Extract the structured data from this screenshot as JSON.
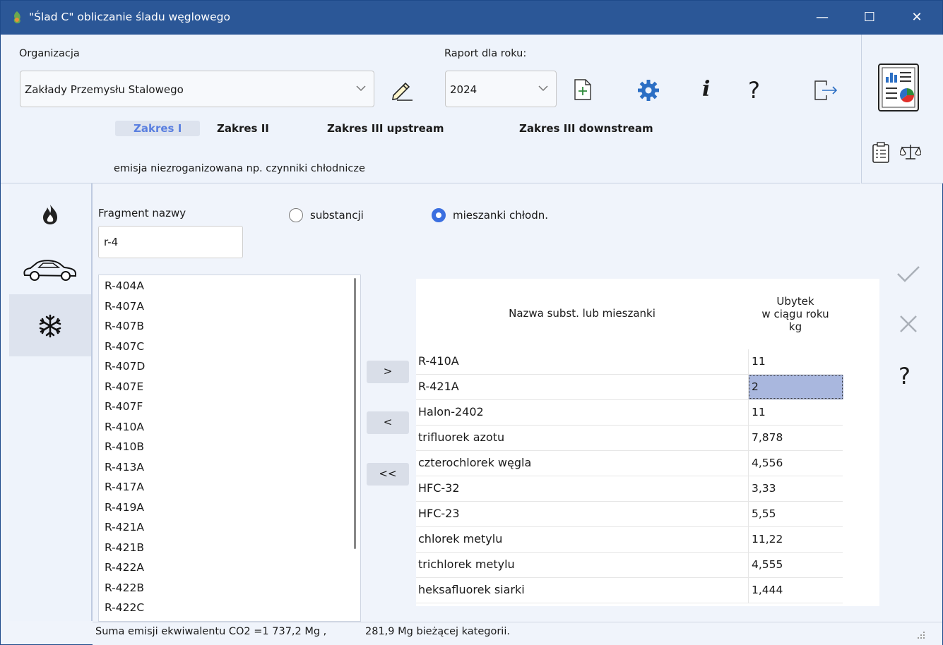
{
  "window": {
    "title": "\"Ślad C\" obliczanie śladu węglowego",
    "minimize_glyph": "—",
    "maximize_glyph": "☐",
    "close_glyph": "✕"
  },
  "header": {
    "org_label": "Organizacja",
    "org_value": "Zakłady Przemysłu Stalowego",
    "year_label": "Raport dla roku:",
    "year_value": "2024",
    "info_glyph": "i",
    "help_glyph": "?"
  },
  "tabs": [
    {
      "label": "Zakres I",
      "active": true
    },
    {
      "label": "Zakres  II",
      "active": false
    },
    {
      "label": "Zakres III upstream",
      "active": false
    },
    {
      "label": "Zakres III downstream",
      "active": false
    }
  ],
  "subtitle": "emisja niezroganizowana np. czynniki chłodnicze",
  "sidebar": {
    "items": [
      {
        "icon": "flame-icon"
      },
      {
        "icon": "car-icon"
      },
      {
        "icon": "snowflake-icon",
        "active": true
      }
    ]
  },
  "search": {
    "label": "Fragment nazwy",
    "value": "r-4"
  },
  "radios": {
    "substance": "substancji",
    "mixture": "mieszanki chłodn.",
    "selected": "mixture"
  },
  "list_items": [
    "R-404A",
    "R-407A",
    "R-407B",
    "R-407C",
    "R-407D",
    "R-407E",
    "R-407F",
    "R-410A",
    "R-410B",
    "R-413A",
    "R-417A",
    "R-419A",
    "R-421A",
    "R-421B",
    "R-422A",
    "R-422B",
    "R-422C"
  ],
  "move_buttons": {
    "add": ">",
    "remove": "<",
    "remove_all": "<<"
  },
  "table": {
    "col1": "Nazwa subst. lub mieszanki",
    "col2_line1": "Ubytek",
    "col2_line2": "w ciągu roku",
    "col2_line3": "kg",
    "rows": [
      {
        "name": "R-410A",
        "value": "11"
      },
      {
        "name": "R-421A",
        "value": "2"
      },
      {
        "name": "Halon-2402",
        "value": "11"
      },
      {
        "name": "trifluorek azotu",
        "value": "7,878"
      },
      {
        "name": "czterochlorek węgla",
        "value": "4,556"
      },
      {
        "name": "HFC-32",
        "value": "3,33"
      },
      {
        "name": "HFC-23",
        "value": "5,55"
      },
      {
        "name": "chlorek metylu",
        "value": "11,22"
      },
      {
        "name": "trichlorek metylu",
        "value": "4,555"
      },
      {
        "name": "heksafluorek siarki",
        "value": "1,444"
      }
    ],
    "selected_row": 1
  },
  "side_actions": {
    "help_glyph": "?"
  },
  "status": {
    "total": "Suma emisji ekwiwalentu CO2 =1 737,2 Mg ,",
    "category": "281,9 Mg bieżącej kategorii."
  },
  "colors": {
    "titlebar": "#2b5797",
    "accent": "#3b6fe0",
    "selection": "#a9b7de"
  }
}
